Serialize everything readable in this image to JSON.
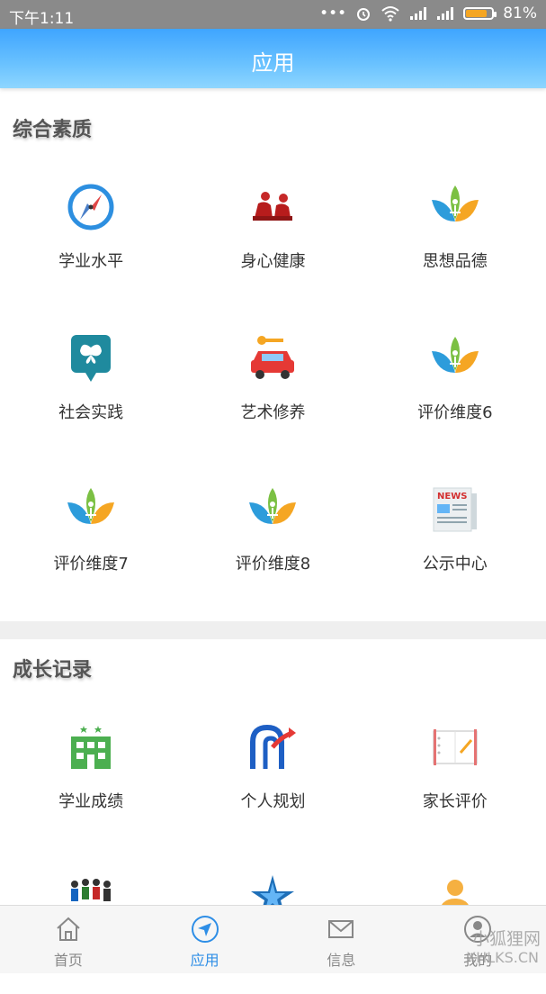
{
  "status_bar": {
    "time": "下午1:11",
    "battery_text": "81%",
    "battery_level": 0.81
  },
  "app_bar": {
    "title": "应用"
  },
  "sections": [
    {
      "title": "综合素质",
      "items": [
        {
          "label": "学业水平",
          "icon": "compass-icon"
        },
        {
          "label": "身心健康",
          "icon": "people-sitting-icon"
        },
        {
          "label": "思想品德",
          "icon": "lotus-icon"
        },
        {
          "label": "社会实践",
          "icon": "butterfly-pin-icon"
        },
        {
          "label": "艺术修养",
          "icon": "car-key-icon"
        },
        {
          "label": "评价维度6",
          "icon": "lotus-icon"
        },
        {
          "label": "评价维度7",
          "icon": "lotus-icon"
        },
        {
          "label": "评价维度8",
          "icon": "lotus-icon"
        },
        {
          "label": "公示中心",
          "icon": "newspaper-icon"
        }
      ]
    },
    {
      "title": "成长记录",
      "items": [
        {
          "label": "学业成绩",
          "icon": "school-building-icon"
        },
        {
          "label": "个人规划",
          "icon": "plan-arrow-icon"
        },
        {
          "label": "家长评价",
          "icon": "notebook-icon"
        },
        {
          "label": "",
          "icon": "crowd-icon"
        },
        {
          "label": "",
          "icon": "star-badge-icon"
        },
        {
          "label": "",
          "icon": "person-bust-icon"
        }
      ]
    }
  ],
  "news_icon_text": "NEWS",
  "tab_bar": [
    {
      "label": "首页",
      "icon": "home-icon",
      "active": false
    },
    {
      "label": "应用",
      "icon": "navigation-icon",
      "active": true
    },
    {
      "label": "信息",
      "icon": "mail-icon",
      "active": false
    },
    {
      "label": "我的",
      "icon": "user-icon",
      "active": false
    }
  ],
  "watermark": {
    "line1": "小狐狸网",
    "line2": "XHLKS.CN"
  },
  "colors": {
    "accent": "#2e8ee6",
    "app_bar": "#4fb2ff",
    "status_bar": "#8a8a8a"
  }
}
